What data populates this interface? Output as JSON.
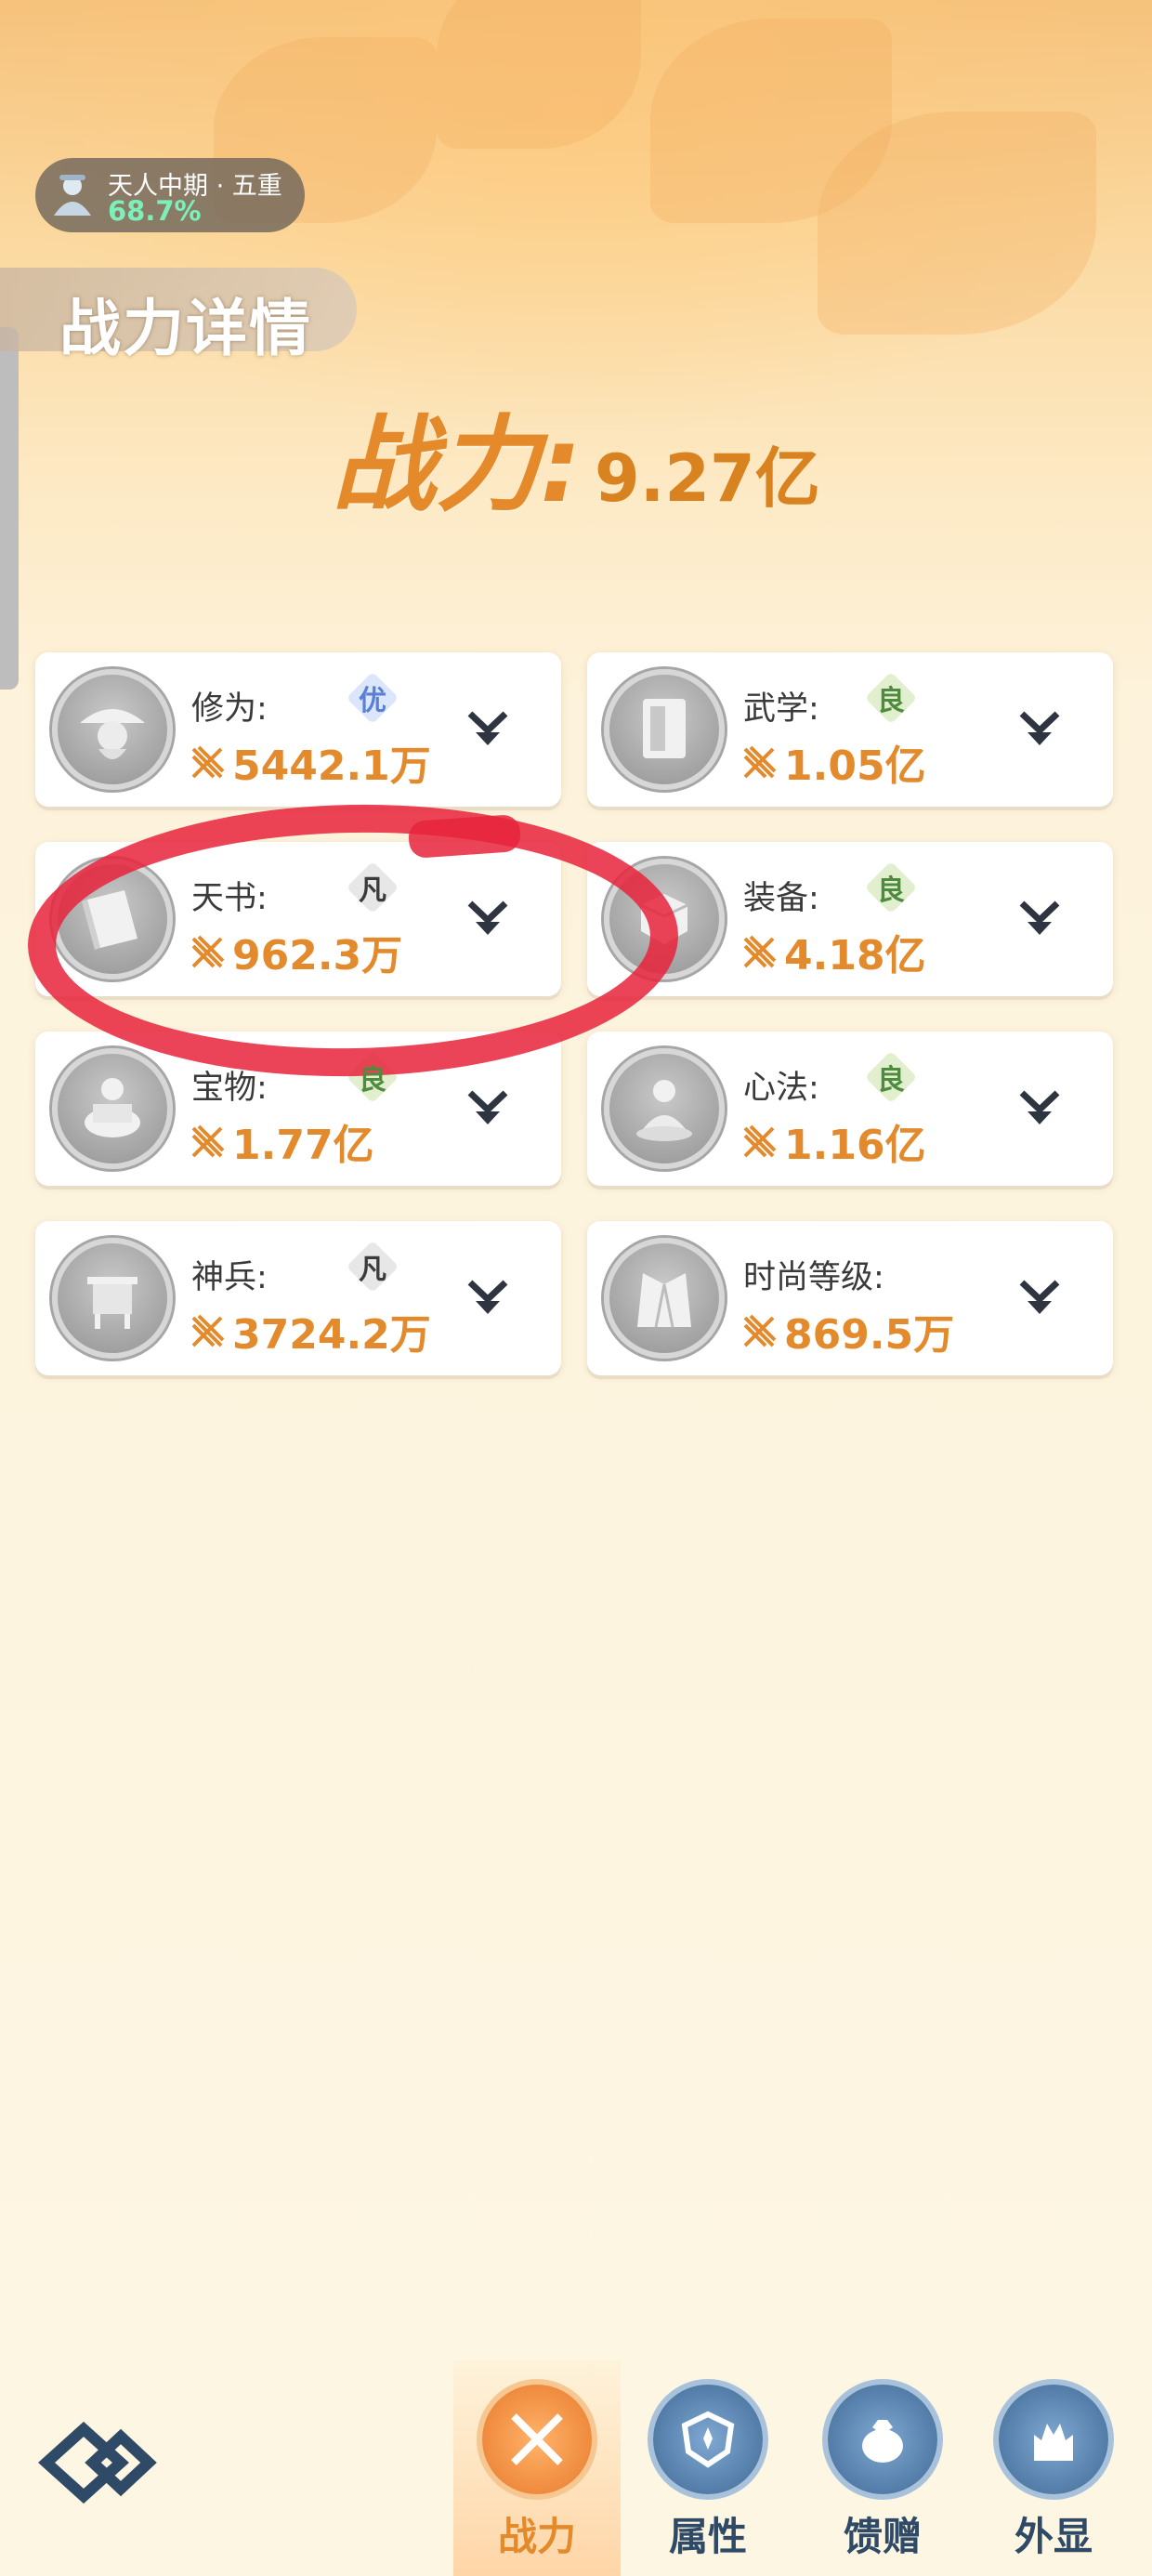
{
  "realm": {
    "name": "天人中期 · 五重",
    "progress": "68.7%"
  },
  "page_title": "战力详情",
  "power": {
    "label": "战力:",
    "value": "9.27亿"
  },
  "cards": [
    {
      "label": "修为:",
      "badge": "优",
      "badge_type": "you",
      "value": "5442.1万",
      "icon": "sage-hat-icon"
    },
    {
      "label": "武学:",
      "badge": "良",
      "badge_type": "liang",
      "value": "1.05亿",
      "icon": "manual-book-icon"
    },
    {
      "label": "天书:",
      "badge": "凡",
      "badge_type": "fan",
      "value": "962.3万",
      "icon": "heavenly-book-icon"
    },
    {
      "label": "装备:",
      "badge": "良",
      "badge_type": "liang",
      "value": "4.18亿",
      "icon": "armor-cube-icon"
    },
    {
      "label": "宝物:",
      "badge": "良",
      "badge_type": "liang",
      "value": "1.77亿",
      "icon": "treasure-pot-icon"
    },
    {
      "label": "心法:",
      "badge": "良",
      "badge_type": "liang",
      "value": "1.16亿",
      "icon": "meditating-figure-icon"
    },
    {
      "label": "神兵:",
      "badge": "凡",
      "badge_type": "fan",
      "value": "3724.2万",
      "icon": "divine-cauldron-icon"
    },
    {
      "label": "时尚等级:",
      "badge": "",
      "badge_type": "",
      "value": "869.5万",
      "icon": "fashion-robe-icon"
    }
  ],
  "tabs": [
    {
      "label": "战力",
      "active": true,
      "icon": "crossed-swords-icon"
    },
    {
      "label": "属性",
      "active": false,
      "icon": "shield-icon"
    },
    {
      "label": "馈赠",
      "active": false,
      "icon": "gift-bag-icon"
    },
    {
      "label": "外显",
      "active": false,
      "icon": "castle-icon"
    }
  ],
  "colors": {
    "accent": "#e58a2a",
    "value": "#e38a2c",
    "annotation": "#e8233c",
    "tab_inactive": "#2e4a66"
  }
}
